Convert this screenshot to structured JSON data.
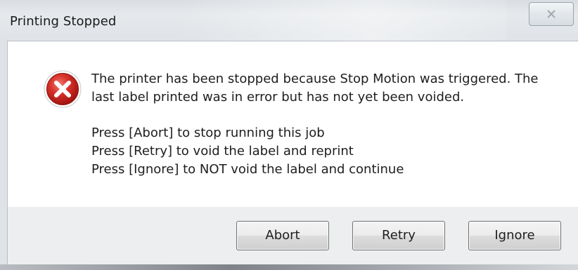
{
  "window": {
    "title": "Printing Stopped",
    "close_icon": "close-icon",
    "close_glyph": "☒"
  },
  "message": {
    "icon": "error-icon",
    "line1": "The printer has been stopped because Stop Motion was triggered.  The",
    "line2": "last label printed was in error but has not yet been voided.",
    "instr1": "Press [Abort] to stop running this job",
    "instr2": "Press [Retry] to void the label and reprint",
    "instr3": "Press [Ignore] to NOT void the label and continue"
  },
  "buttons": {
    "abort": "Abort",
    "retry": "Retry",
    "ignore": "Ignore"
  },
  "colors": {
    "error_red": "#d32a24",
    "client_bg": "#ffffff",
    "footer_bg": "#eceef0"
  }
}
